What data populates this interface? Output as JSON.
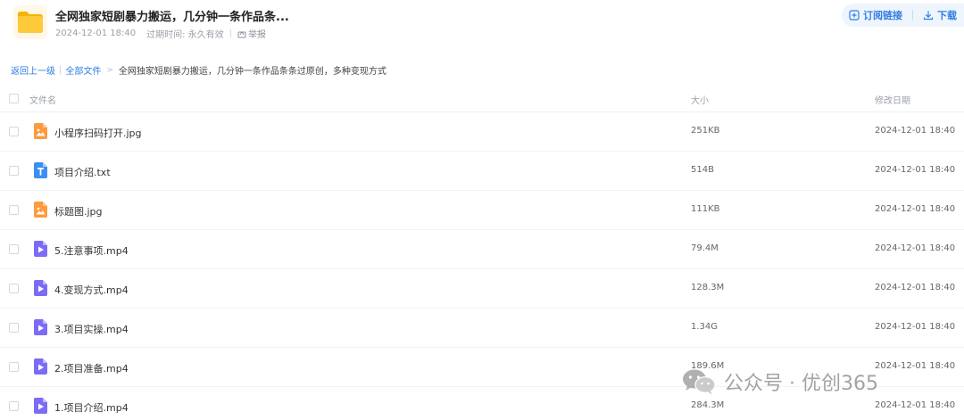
{
  "share": {
    "title": "全网独家短剧暴力搬运，几分钟一条作品条...",
    "created": "2024-12-01 18:40",
    "expire_label": "过期时间: 永久有效",
    "report_label": "举报",
    "icon": "folder-icon"
  },
  "actions": {
    "subscribe_label": "订阅链接",
    "download_label": "下载"
  },
  "breadcrumb": {
    "back_label": "返回上一级",
    "all_files_label": "全部文件",
    "current": "全网独家短剧暴力搬运，几分钟一条作品条条过原创，多种变现方式"
  },
  "table": {
    "columns": {
      "name": "文件名",
      "size": "大小",
      "date": "修改日期"
    },
    "rows": [
      {
        "name": "小程序扫码打开.jpg",
        "size": "251KB",
        "date": "2024-12-01 18:40",
        "icon": "image-file-icon"
      },
      {
        "name": "项目介绍.txt",
        "size": "514B",
        "date": "2024-12-01 18:40",
        "icon": "text-file-icon"
      },
      {
        "name": "标题图.jpg",
        "size": "111KB",
        "date": "2024-12-01 18:40",
        "icon": "image-file-icon"
      },
      {
        "name": "5.注意事项.mp4",
        "size": "79.4M",
        "date": "2024-12-01 18:40",
        "icon": "video-file-icon"
      },
      {
        "name": "4.变现方式.mp4",
        "size": "128.3M",
        "date": "2024-12-01 18:40",
        "icon": "video-file-icon"
      },
      {
        "name": "3.项目实操.mp4",
        "size": "1.34G",
        "date": "2024-12-01 18:40",
        "icon": "video-file-icon"
      },
      {
        "name": "2.项目准备.mp4",
        "size": "189.6M",
        "date": "2024-12-01 18:40",
        "icon": "video-file-icon"
      },
      {
        "name": "1.项目介绍.mp4",
        "size": "284.3M",
        "date": "2024-12-01 18:40",
        "icon": "video-file-icon"
      }
    ]
  },
  "watermark": {
    "text": "公众号 · 优创365",
    "icon": "wechat-icon"
  },
  "colors": {
    "accent": "#2f7de1",
    "folder": "#ffc93c",
    "image_file": "#ff9a3d",
    "text_file": "#3b8ef3",
    "video_file": "#7b6cf6"
  }
}
